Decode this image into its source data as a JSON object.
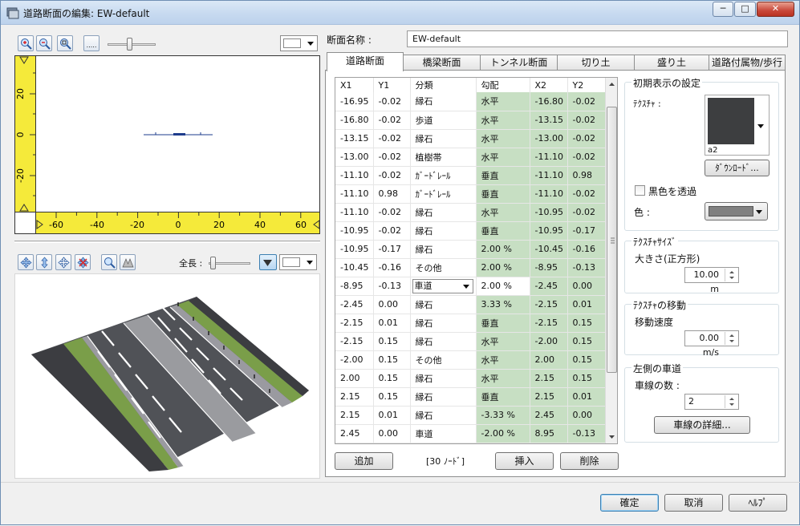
{
  "window": {
    "title": "道路断面の編集: EW-default",
    "min_glyph": "─",
    "max_glyph": "□",
    "close_glyph": "✕"
  },
  "toolbar1": {
    "dots_label": "....."
  },
  "plot": {
    "y_ticks": [
      "20",
      "0",
      "-20"
    ],
    "x_ticks": [
      "-60",
      "-40",
      "-20",
      "0",
      "20",
      "40",
      "60"
    ]
  },
  "toolbar2": {
    "length_label": "全長 :"
  },
  "form": {
    "name_label": "断面名称 :",
    "name_value": "EW-default"
  },
  "tabs": [
    "道路断面",
    "橋梁断面",
    "トンネル断面",
    "切り土",
    "盛り土",
    "道路付属物/歩行"
  ],
  "table": {
    "headers": [
      "X1",
      "Y1",
      "分類",
      "勾配",
      "X2",
      "Y2"
    ],
    "rows": [
      [
        "-16.95",
        "-0.02",
        "縁石",
        "水平",
        "-16.80",
        "-0.02"
      ],
      [
        "-16.80",
        "-0.02",
        "歩道",
        "水平",
        "-13.15",
        "-0.02"
      ],
      [
        "-13.15",
        "-0.02",
        "縁石",
        "水平",
        "-13.00",
        "-0.02"
      ],
      [
        "-13.00",
        "-0.02",
        "植樹帯",
        "水平",
        "-11.10",
        "-0.02"
      ],
      [
        "-11.10",
        "-0.02",
        "ｶﾞｰﾄﾞﾚｰﾙ",
        "垂直",
        "-11.10",
        "0.98"
      ],
      [
        "-11.10",
        "0.98",
        "ｶﾞｰﾄﾞﾚｰﾙ",
        "垂直",
        "-11.10",
        "-0.02"
      ],
      [
        "-11.10",
        "-0.02",
        "縁石",
        "水平",
        "-10.95",
        "-0.02"
      ],
      [
        "-10.95",
        "-0.02",
        "縁石",
        "垂直",
        "-10.95",
        "-0.17"
      ],
      [
        "-10.95",
        "-0.17",
        "縁石",
        "2.00 %",
        "-10.45",
        "-0.16"
      ],
      [
        "-10.45",
        "-0.16",
        "その他",
        "2.00 %",
        "-8.95",
        "-0.13"
      ],
      [
        "-8.95",
        "-0.13",
        "車道",
        "2.00 %",
        "-2.45",
        "0.00"
      ],
      [
        "-2.45",
        "0.00",
        "縁石",
        "3.33 %",
        "-2.15",
        "0.01"
      ],
      [
        "-2.15",
        "0.01",
        "縁石",
        "垂直",
        "-2.15",
        "0.15"
      ],
      [
        "-2.15",
        "0.15",
        "縁石",
        "水平",
        "-2.00",
        "0.15"
      ],
      [
        "-2.00",
        "0.15",
        "その他",
        "水平",
        "2.00",
        "0.15"
      ],
      [
        "2.00",
        "0.15",
        "縁石",
        "水平",
        "2.15",
        "0.15"
      ],
      [
        "2.15",
        "0.15",
        "縁石",
        "垂直",
        "2.15",
        "0.01"
      ],
      [
        "2.15",
        "0.01",
        "縁石",
        "-3.33 %",
        "2.45",
        "0.00"
      ],
      [
        "2.45",
        "0.00",
        "車道",
        "-2.00 %",
        "8.95",
        "-0.13"
      ]
    ],
    "selected_row": 10,
    "node_count": "[30 ﾉｰﾄﾞ]"
  },
  "buttons": {
    "add": "追加",
    "insert": "挿入",
    "delete": "削除",
    "ok": "確定",
    "cancel": "取消",
    "help": "ﾍﾙﾌﾟ"
  },
  "initial": {
    "group_title": "初期表示の設定",
    "texture_label": "ﾃｸｽﾁｬ :",
    "texture_name": "a2",
    "download": "ﾀﾞｳﾝﾛｰﾄﾞ...",
    "black_transparent": "黒色を透過",
    "color_label": "色 :",
    "color_value": "#808080"
  },
  "texsize": {
    "group_title": "ﾃｸｽﾁｬｻｲｽﾞ",
    "label": "大きさ(正方形)",
    "value": "10.00 m"
  },
  "texmove": {
    "group_title": "ﾃｸｽﾁｬの移動",
    "label": "移動速度",
    "value": "0.00 m/s"
  },
  "leftlane": {
    "group_title": "左側の車道",
    "label": "車線の数 :",
    "value": "2",
    "detail_button": "車線の詳細..."
  }
}
